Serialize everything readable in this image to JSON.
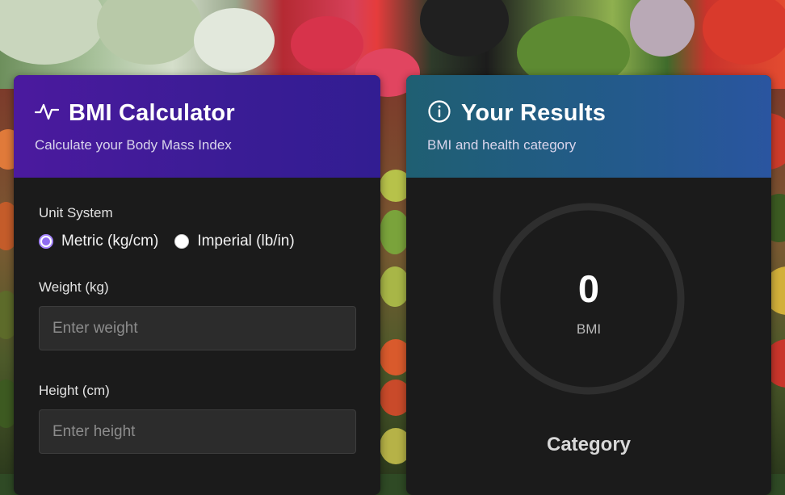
{
  "calculator": {
    "title": "BMI Calculator",
    "subtitle": "Calculate your Body Mass Index",
    "icon": "activity-icon",
    "unit_system_label": "Unit System",
    "units": [
      {
        "label": "Metric (kg/cm)",
        "checked": true
      },
      {
        "label": "Imperial (lb/in)",
        "checked": false
      }
    ],
    "weight": {
      "label": "Weight (kg)",
      "placeholder": "Enter weight",
      "value": ""
    },
    "height": {
      "label": "Height (cm)",
      "placeholder": "Enter height",
      "value": ""
    }
  },
  "results": {
    "title": "Your Results",
    "subtitle": "BMI and health category",
    "icon": "info-icon",
    "bmi_value": "0",
    "bmi_unit": "BMI",
    "category_title": "Category"
  },
  "colors": {
    "calculator_header": "#3a1c95",
    "results_header": "#235a8c",
    "card_bg": "#1b1b1b",
    "radio_accent": "#8f6cf0"
  }
}
